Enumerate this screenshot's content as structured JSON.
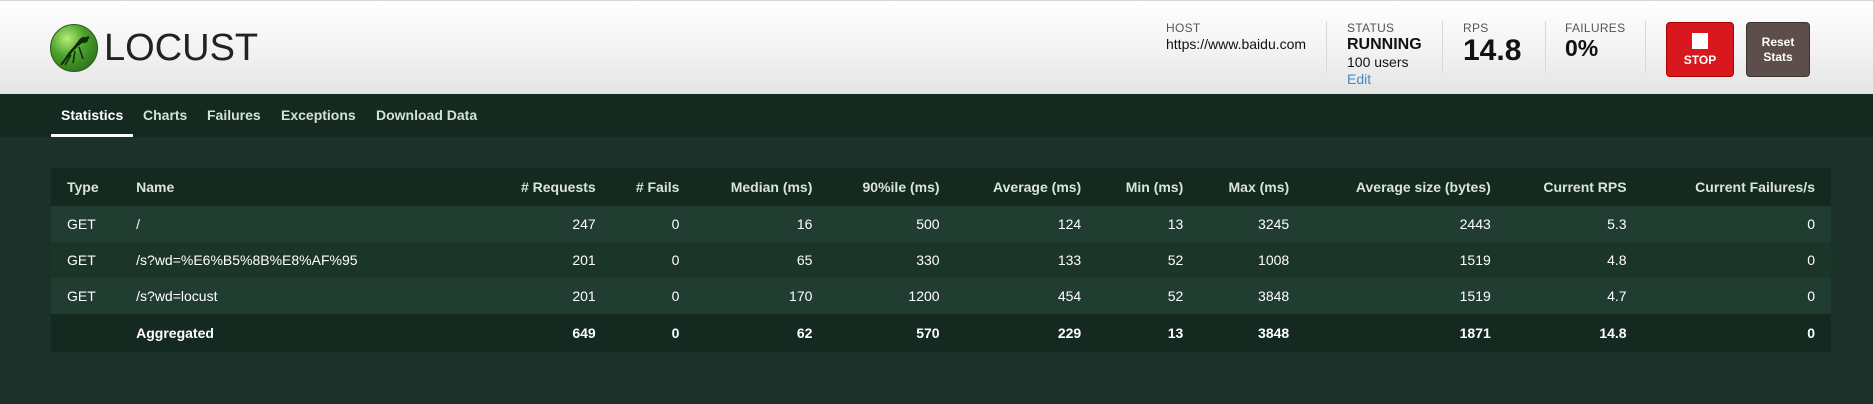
{
  "logo": {
    "text": "LOCUST"
  },
  "header": {
    "host_label": "HOST",
    "host_value": "https://www.baidu.com",
    "status_label": "STATUS",
    "status_value": "RUNNING",
    "users": "100 users",
    "edit": "Edit",
    "rps_label": "RPS",
    "rps_value": "14.8",
    "failures_label": "FAILURES",
    "failures_value": "0%",
    "stop_label": "STOP",
    "reset_line1": "Reset",
    "reset_line2": "Stats"
  },
  "colors": {
    "stop": "#d8171e",
    "reset": "#5d4d4b",
    "background": "#1c3129",
    "link": "#3c8dc8"
  },
  "nav": {
    "tabs": [
      {
        "label": "Statistics",
        "active": true
      },
      {
        "label": "Charts"
      },
      {
        "label": "Failures"
      },
      {
        "label": "Exceptions"
      },
      {
        "label": "Download Data"
      }
    ]
  },
  "table": {
    "headers": [
      "Type",
      "Name",
      "# Requests",
      "# Fails",
      "Median (ms)",
      "90%ile (ms)",
      "Average (ms)",
      "Min (ms)",
      "Max (ms)",
      "Average size (bytes)",
      "Current RPS",
      "Current Failures/s"
    ],
    "rows": [
      [
        "GET",
        "/",
        "247",
        "0",
        "16",
        "500",
        "124",
        "13",
        "3245",
        "2443",
        "5.3",
        "0"
      ],
      [
        "GET",
        "/s?wd=%E6%B5%8B%E8%AF%95",
        "201",
        "0",
        "65",
        "330",
        "133",
        "52",
        "1008",
        "1519",
        "4.8",
        "0"
      ],
      [
        "GET",
        "/s?wd=locust",
        "201",
        "0",
        "170",
        "1200",
        "454",
        "52",
        "3848",
        "1519",
        "4.7",
        "0"
      ]
    ],
    "aggregated": [
      "",
      "Aggregated",
      "649",
      "0",
      "62",
      "570",
      "229",
      "13",
      "3848",
      "1871",
      "14.8",
      "0"
    ]
  }
}
